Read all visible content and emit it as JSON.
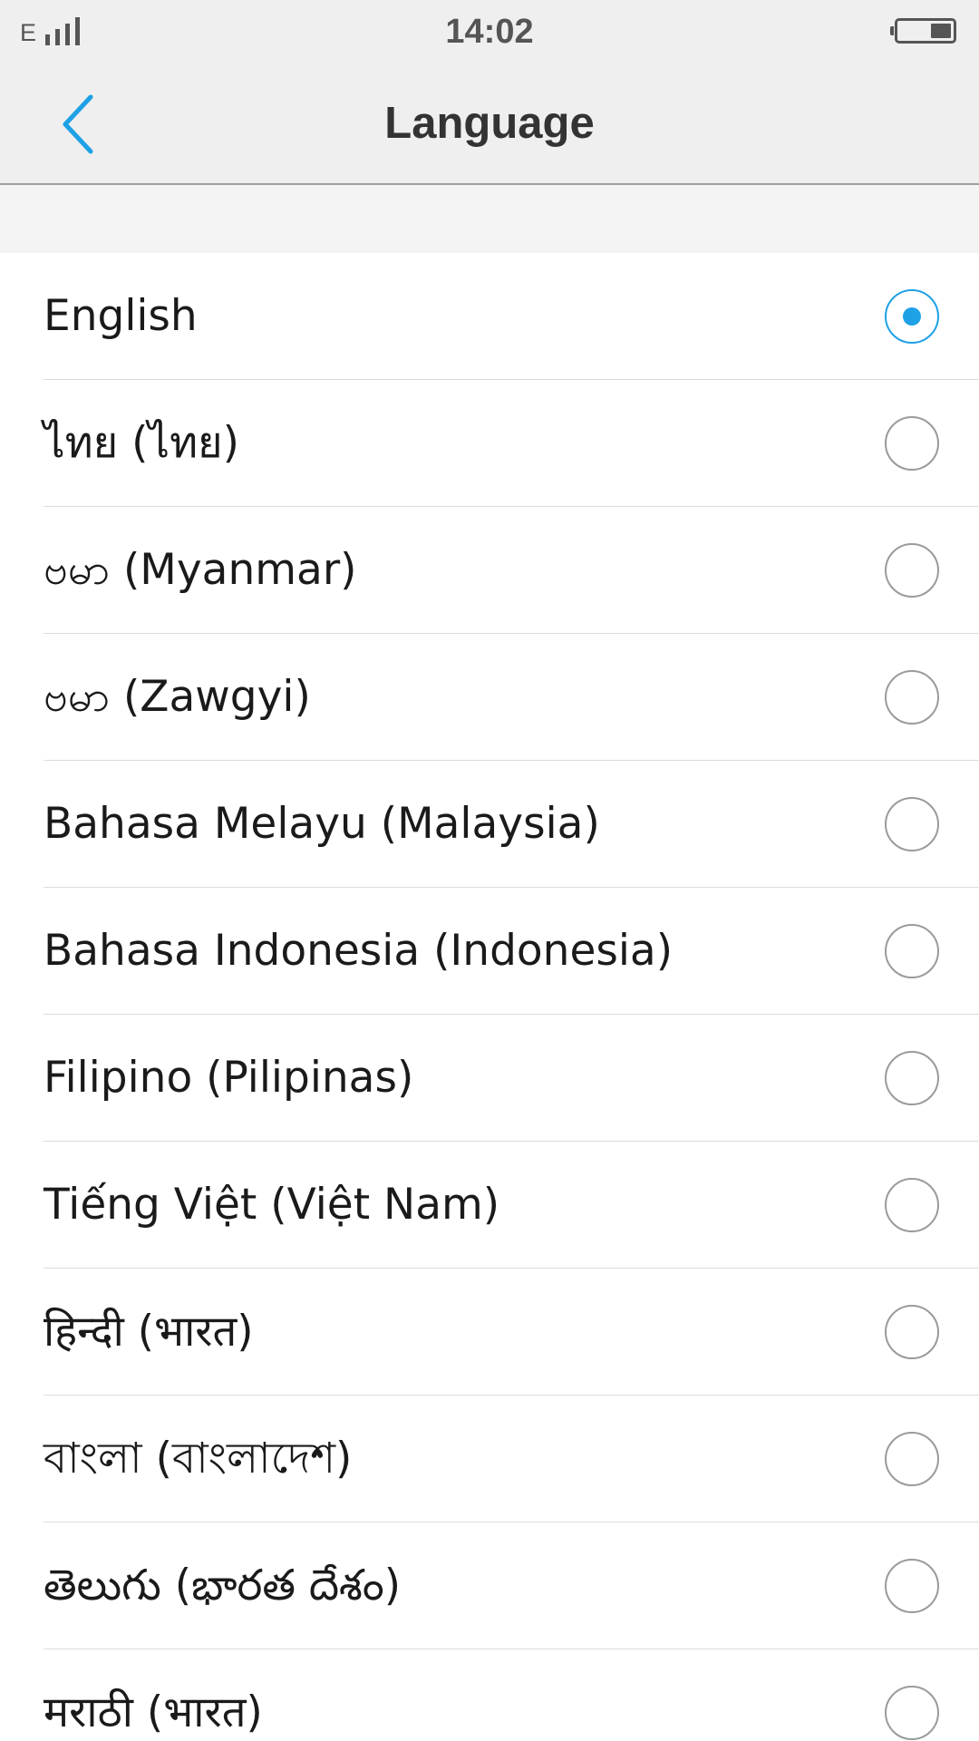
{
  "status_bar": {
    "network_type": "E",
    "signal_icon": "signal-bars-icon",
    "time": "14:02",
    "battery_icon": "battery-icon"
  },
  "header": {
    "back_icon": "chevron-left-icon",
    "title": "Language"
  },
  "colors": {
    "accent": "#1ea1e6",
    "header_bg": "#efefef",
    "text": "#1a1a1a"
  },
  "languages": [
    {
      "label": "English",
      "selected": true
    },
    {
      "label": "ไทย (ไทย)",
      "selected": false
    },
    {
      "label": "ဗမာ (Myanmar)",
      "selected": false
    },
    {
      "label": "ဗမာ (Zawgyi)",
      "selected": false
    },
    {
      "label": "Bahasa Melayu (Malaysia)",
      "selected": false
    },
    {
      "label": "Bahasa Indonesia (Indonesia)",
      "selected": false
    },
    {
      "label": "Filipino (Pilipinas)",
      "selected": false
    },
    {
      "label": "Tiếng Việt (Việt Nam)",
      "selected": false
    },
    {
      "label": "हिन्दी (भारत)",
      "selected": false
    },
    {
      "label": "বাংলা (বাংলাদেশ)",
      "selected": false
    },
    {
      "label": "తెలుగు (భారత దేశం)",
      "selected": false
    },
    {
      "label": "मराठी (भारत)",
      "selected": false
    }
  ]
}
